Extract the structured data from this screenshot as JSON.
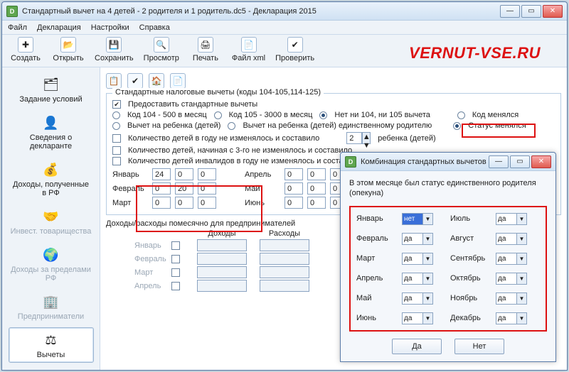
{
  "mainWindow": {
    "title": "Стандартный вычет на 4 детей - 2 родителя и 1 родитель.dc5 - Декларация 2015",
    "menu": [
      "Файл",
      "Декларация",
      "Настройки",
      "Справка"
    ],
    "toolbar": [
      {
        "label": "Создать",
        "icon": "✚"
      },
      {
        "label": "Открыть",
        "icon": "📂"
      },
      {
        "label": "Сохранить",
        "icon": "💾"
      },
      {
        "label": "Просмотр",
        "icon": "🔍"
      },
      {
        "label": "Печать",
        "icon": "🖨"
      },
      {
        "label": "Файл xml",
        "icon": "📄"
      },
      {
        "label": "Проверить",
        "icon": "✔"
      }
    ],
    "sidebar": [
      {
        "label": "Задание условий",
        "icon": "🗂"
      },
      {
        "label": "Сведения о декларанте",
        "icon": "👤"
      },
      {
        "label": "Доходы, полученные в РФ",
        "icon": "💰"
      },
      {
        "label": "Инвест. товарищества",
        "icon": "🤝",
        "disabled": true
      },
      {
        "label": "Доходы за пределами РФ",
        "icon": "🌍",
        "disabled": true
      },
      {
        "label": "Предприниматели",
        "icon": "🏢",
        "disabled": true
      },
      {
        "label": "Вычеты",
        "icon": "⚖",
        "selected": true
      }
    ]
  },
  "panel": {
    "groupTitle": "Стандартные налоговые вычеты (коды 104-105,114-125)",
    "chkProvide": "Предоставить стандартные вычеты",
    "radios1": [
      "Код 104 - 500 в месяц",
      "Код 105 - 3000 в месяц",
      "Нет ни 104, ни 105 вычета",
      "Код менялся"
    ],
    "radios1_sel": 2,
    "radios2": [
      "Вычет на ребенка (детей)",
      "Вычет на ребенка (детей) единственному родителю",
      "Статус менялся"
    ],
    "radios2_sel": 2,
    "chkRows": [
      "Количество детей в году не изменялось и составило",
      "Количество детей, начиная с 3-го не изменялось и составило",
      "Количество детей инвалидов в году не изменялось и составило"
    ],
    "spinValue": "2",
    "spinLabel": "ребенка (детей)",
    "months": {
      "jan": "Январь",
      "feb": "Февраль",
      "mar": "Март",
      "apr": "Апрель",
      "may": "Май",
      "jun": "Июнь"
    },
    "grid": [
      [
        "24",
        "0",
        "0"
      ],
      [
        "0",
        "20",
        "0"
      ],
      [
        "0",
        "0",
        "0"
      ],
      [
        "0",
        "0",
        "0"
      ],
      [
        "0",
        "0",
        "0"
      ],
      [
        "0",
        "0",
        "0"
      ]
    ],
    "section2": "Доходы/расходы помесячно для предпринимателей",
    "colHeads": [
      "Доходы",
      "Расходы"
    ],
    "predMonths": [
      "Январь",
      "Февраль",
      "Март",
      "Апрель"
    ]
  },
  "dialog": {
    "title": "Комбинация стандартных вычетов",
    "desc": "В этом месяце был статус единственного родителя (опекуна)",
    "leftMonths": [
      "Январь",
      "Февраль",
      "Март",
      "Апрель",
      "Май",
      "Июнь"
    ],
    "rightMonths": [
      "Июль",
      "Август",
      "Сентябрь",
      "Октябрь",
      "Ноябрь",
      "Декабрь"
    ],
    "ddValues": [
      "нет",
      "да",
      "да",
      "да",
      "да",
      "да",
      "да",
      "да",
      "да",
      "да",
      "да",
      "да"
    ],
    "btnYes": "Да",
    "btnNo": "Нет"
  },
  "watermark": "VERNUT-VSE.RU"
}
